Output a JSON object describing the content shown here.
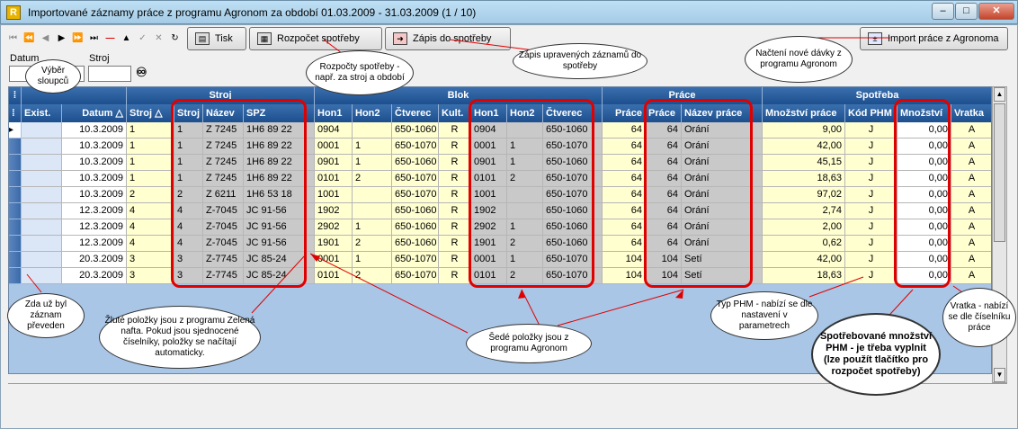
{
  "window": {
    "title": "Importované záznamy práce z programu Agronom za období 01.03.2009 - 31.03.2009 (1 / 10)",
    "min_label": "–",
    "max_label": "□",
    "close_label": "✕"
  },
  "toolbar": {
    "tisk": "Tisk",
    "rozpocet": "Rozpočet spotřeby",
    "zapis": "Zápis do spotřeby",
    "import": "Import práce z Agronoma"
  },
  "filters": {
    "datum_label": "Datum",
    "stroj_label": "Stroj",
    "datum_value": "",
    "stroj_value": ""
  },
  "grid": {
    "groups": {
      "stroj": "Stroj",
      "blok": "Blok",
      "prace": "Práce",
      "spotreba": "Spotřeba"
    },
    "headers": {
      "exist": "Exist.",
      "datum": "Datum",
      "stroj": "Stroj",
      "stroj2": "Stroj",
      "nazev": "Název",
      "spz": "SPZ",
      "hon1": "Hon1",
      "hon2": "Hon2",
      "ctverec": "Čtverec",
      "kult": "Kult.",
      "hon1b": "Hon1",
      "hon2b": "Hon2",
      "ctverecb": "Čtverec",
      "prace": "Práce",
      "prace2": "Práce",
      "nazev_prace": "Název práce",
      "mnozstvi_prace": "Množství práce",
      "kod_phm": "Kód PHM",
      "mnozstvi": "Množství",
      "vratka": "Vratka"
    },
    "rows": [
      {
        "datum": "10.3.2009",
        "stroj": "1",
        "stroj2": "1",
        "nazev": "Z 7245",
        "spz": "1H6 89 22",
        "hon1": "0904",
        "hon2": "",
        "ctverec": "650-1060",
        "kult": "R",
        "hon1b": "0904",
        "hon2b": "",
        "ctverecb": "650-1060",
        "prace": "64",
        "prace2": "64",
        "nazev_prace": "Orání",
        "mnozstvi_prace": "9,00",
        "kod": "J",
        "mnozstvi": "0,00",
        "vratka": "A"
      },
      {
        "datum": "10.3.2009",
        "stroj": "1",
        "stroj2": "1",
        "nazev": "Z 7245",
        "spz": "1H6 89 22",
        "hon1": "0001",
        "hon2": "1",
        "ctverec": "650-1070",
        "kult": "R",
        "hon1b": "0001",
        "hon2b": "1",
        "ctverecb": "650-1070",
        "prace": "64",
        "prace2": "64",
        "nazev_prace": "Orání",
        "mnozstvi_prace": "42,00",
        "kod": "J",
        "mnozstvi": "0,00",
        "vratka": "A"
      },
      {
        "datum": "10.3.2009",
        "stroj": "1",
        "stroj2": "1",
        "nazev": "Z 7245",
        "spz": "1H6 89 22",
        "hon1": "0901",
        "hon2": "1",
        "ctverec": "650-1060",
        "kult": "R",
        "hon1b": "0901",
        "hon2b": "1",
        "ctverecb": "650-1060",
        "prace": "64",
        "prace2": "64",
        "nazev_prace": "Orání",
        "mnozstvi_prace": "45,15",
        "kod": "J",
        "mnozstvi": "0,00",
        "vratka": "A"
      },
      {
        "datum": "10.3.2009",
        "stroj": "1",
        "stroj2": "1",
        "nazev": "Z 7245",
        "spz": "1H6 89 22",
        "hon1": "0101",
        "hon2": "2",
        "ctverec": "650-1070",
        "kult": "R",
        "hon1b": "0101",
        "hon2b": "2",
        "ctverecb": "650-1070",
        "prace": "64",
        "prace2": "64",
        "nazev_prace": "Orání",
        "mnozstvi_prace": "18,63",
        "kod": "J",
        "mnozstvi": "0,00",
        "vratka": "A"
      },
      {
        "datum": "10.3.2009",
        "stroj": "2",
        "stroj2": "2",
        "nazev": "Z 6211",
        "spz": "1H6 53 18",
        "hon1": "1001",
        "hon2": "",
        "ctverec": "650-1070",
        "kult": "R",
        "hon1b": "1001",
        "hon2b": "",
        "ctverecb": "650-1070",
        "prace": "64",
        "prace2": "64",
        "nazev_prace": "Orání",
        "mnozstvi_prace": "97,02",
        "kod": "J",
        "mnozstvi": "0,00",
        "vratka": "A"
      },
      {
        "datum": "12.3.2009",
        "stroj": "4",
        "stroj2": "4",
        "nazev": "Z-7045",
        "spz": "JC 91-56",
        "hon1": "1902",
        "hon2": "",
        "ctverec": "650-1060",
        "kult": "R",
        "hon1b": "1902",
        "hon2b": "",
        "ctverecb": "650-1060",
        "prace": "64",
        "prace2": "64",
        "nazev_prace": "Orání",
        "mnozstvi_prace": "2,74",
        "kod": "J",
        "mnozstvi": "0,00",
        "vratka": "A"
      },
      {
        "datum": "12.3.2009",
        "stroj": "4",
        "stroj2": "4",
        "nazev": "Z-7045",
        "spz": "JC 91-56",
        "hon1": "2902",
        "hon2": "1",
        "ctverec": "650-1060",
        "kult": "R",
        "hon1b": "2902",
        "hon2b": "1",
        "ctverecb": "650-1060",
        "prace": "64",
        "prace2": "64",
        "nazev_prace": "Orání",
        "mnozstvi_prace": "2,00",
        "kod": "J",
        "mnozstvi": "0,00",
        "vratka": "A"
      },
      {
        "datum": "12.3.2009",
        "stroj": "4",
        "stroj2": "4",
        "nazev": "Z-7045",
        "spz": "JC 91-56",
        "hon1": "1901",
        "hon2": "2",
        "ctverec": "650-1060",
        "kult": "R",
        "hon1b": "1901",
        "hon2b": "2",
        "ctverecb": "650-1060",
        "prace": "64",
        "prace2": "64",
        "nazev_prace": "Orání",
        "mnozstvi_prace": "0,62",
        "kod": "J",
        "mnozstvi": "0,00",
        "vratka": "A"
      },
      {
        "datum": "20.3.2009",
        "stroj": "3",
        "stroj2": "3",
        "nazev": "Z-7745",
        "spz": "JC 85-24",
        "hon1": "0001",
        "hon2": "1",
        "ctverec": "650-1070",
        "kult": "R",
        "hon1b": "0001",
        "hon2b": "1",
        "ctverecb": "650-1070",
        "prace": "104",
        "prace2": "104",
        "nazev_prace": "Setí",
        "mnozstvi_prace": "42,00",
        "kod": "J",
        "mnozstvi": "0,00",
        "vratka": "A"
      },
      {
        "datum": "20.3.2009",
        "stroj": "3",
        "stroj2": "3",
        "nazev": "Z-7745",
        "spz": "JC 85-24",
        "hon1": "0101",
        "hon2": "2",
        "ctverec": "650-1070",
        "kult": "R",
        "hon1b": "0101",
        "hon2b": "2",
        "ctverecb": "650-1070",
        "prace": "104",
        "prace2": "104",
        "nazev_prace": "Setí",
        "mnozstvi_prace": "18,63",
        "kod": "J",
        "mnozstvi": "0,00",
        "vratka": "A"
      }
    ]
  },
  "callouts": {
    "vyber": "Výběr sloupců",
    "rozpocty": "Rozpočty spotřeby - např. za stroj a období",
    "zapis": "Zápis upravených záznamů do spotřeby",
    "nacteni": "Načtení nové dávky z programu Agronom",
    "zda": "Zda už byl záznam převeden",
    "zlute": "Žluté položky jsou z programu Zelená nafta. Pokud jsou sjednocené číselníky, položky se načítají automaticky.",
    "sede": "Šedé položky jsou z programu Agronom",
    "typ": "Typ PHM - nabízí se dle nastavení v parametrech",
    "spotrebovane": "Spotřebované množství PHM - je třeba vyplnit (lze použít tlačítko pro rozpočet spotřeby)",
    "vratka": "Vratka - nabízí se dle číselníku práce"
  }
}
